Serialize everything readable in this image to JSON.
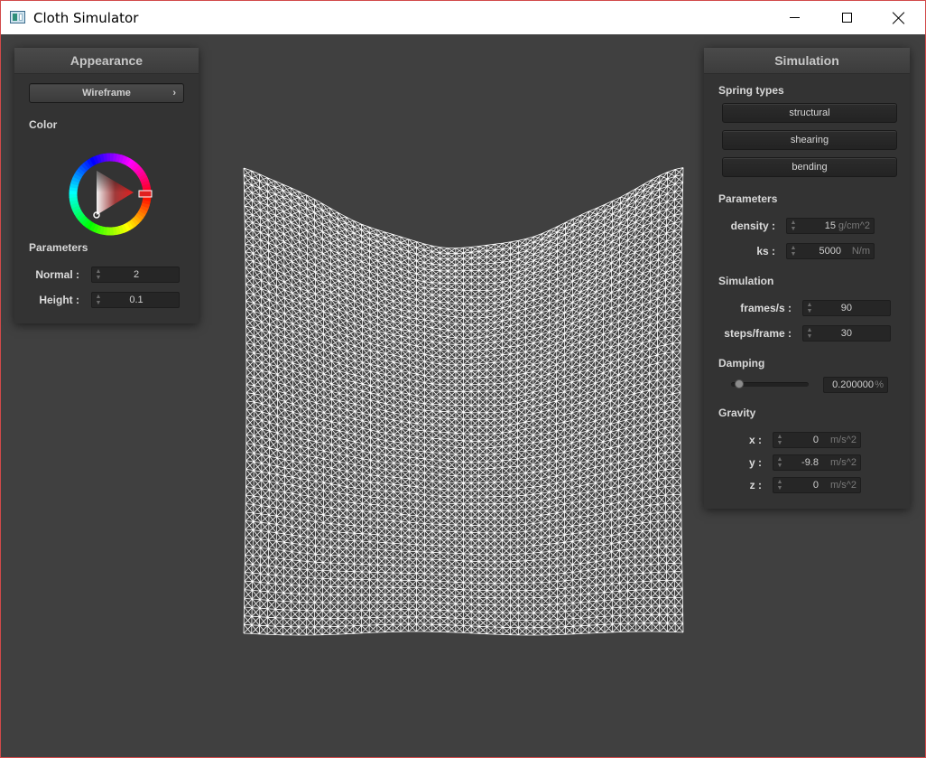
{
  "window": {
    "title": "Cloth Simulator",
    "controls": {
      "minimize": "minimize-icon",
      "maximize": "maximize-icon",
      "close": "close-icon"
    }
  },
  "appearance_panel": {
    "title": "Appearance",
    "shading_mode": "Wireframe",
    "color_label": "Color",
    "color_wheel_value": "#e03030",
    "parameters_label": "Parameters",
    "normal": {
      "label": "Normal :",
      "value": "2"
    },
    "height": {
      "label": "Height :",
      "value": "0.1"
    }
  },
  "simulation_panel": {
    "title": "Simulation",
    "spring_types_label": "Spring types",
    "spring_types": [
      "structural",
      "shearing",
      "bending"
    ],
    "parameters_label": "Parameters",
    "density": {
      "label": "density :",
      "value": "15",
      "unit": "g/cm^2"
    },
    "ks": {
      "label": "ks :",
      "value": "5000",
      "unit": "N/m"
    },
    "simulation_label": "Simulation",
    "frames_per_s": {
      "label": "frames/s :",
      "value": "90"
    },
    "steps_per_frame": {
      "label": "steps/frame :",
      "value": "30"
    },
    "damping_label": "Damping",
    "damping": {
      "value": "0.200000",
      "unit": "%",
      "slider_fraction": 0.2
    },
    "gravity_label": "Gravity",
    "gravity": [
      {
        "label": "x :",
        "value": "0",
        "unit": "m/s^2"
      },
      {
        "label": "y :",
        "value": "-9.8",
        "unit": "m/s^2"
      },
      {
        "label": "z :",
        "value": "0",
        "unit": "m/s^2"
      }
    ]
  },
  "viewport": {
    "background": "#404040",
    "mesh_color": "#ffffff",
    "render_mode": "wireframe"
  }
}
